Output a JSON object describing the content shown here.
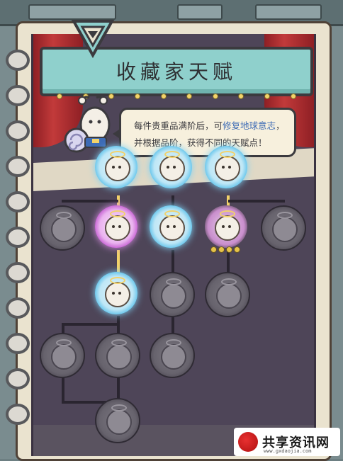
{
  "title": "收藏家天赋",
  "bubble": {
    "line1_prefix": "每件贵重品满阶后，可",
    "line1_highlight": "修复地球意志",
    "line1_suffix": "，",
    "line2": "并根据品阶，获得不同的天赋点！"
  },
  "talent_tree": {
    "nodes": [
      {
        "id": "t1",
        "state": "unlocked-blue"
      },
      {
        "id": "t2",
        "state": "unlocked-blue"
      },
      {
        "id": "t3",
        "state": "unlocked-blue"
      },
      {
        "id": "m1",
        "state": "locked"
      },
      {
        "id": "m2",
        "state": "unlocked-purple"
      },
      {
        "id": "m3",
        "state": "unlocked-blue"
      },
      {
        "id": "m4",
        "state": "partial-pink",
        "progress_dots": 4
      },
      {
        "id": "m5",
        "state": "locked"
      },
      {
        "id": "r3a",
        "state": "unlocked-blue"
      },
      {
        "id": "r3b",
        "state": "locked"
      },
      {
        "id": "r3c",
        "state": "locked"
      },
      {
        "id": "r4a",
        "state": "locked"
      },
      {
        "id": "r4b",
        "state": "locked"
      },
      {
        "id": "r4c",
        "state": "locked"
      },
      {
        "id": "r5a",
        "state": "locked"
      }
    ]
  },
  "watermark": {
    "text": "共享资讯网",
    "sub": "www.gxdaojia.com"
  },
  "colors": {
    "banner": "#8fd0cc",
    "blue_glow": "#59c0ea",
    "purple_glow": "#c157cf",
    "gold": "#f2d26a",
    "page_bg": "#4e4558"
  }
}
